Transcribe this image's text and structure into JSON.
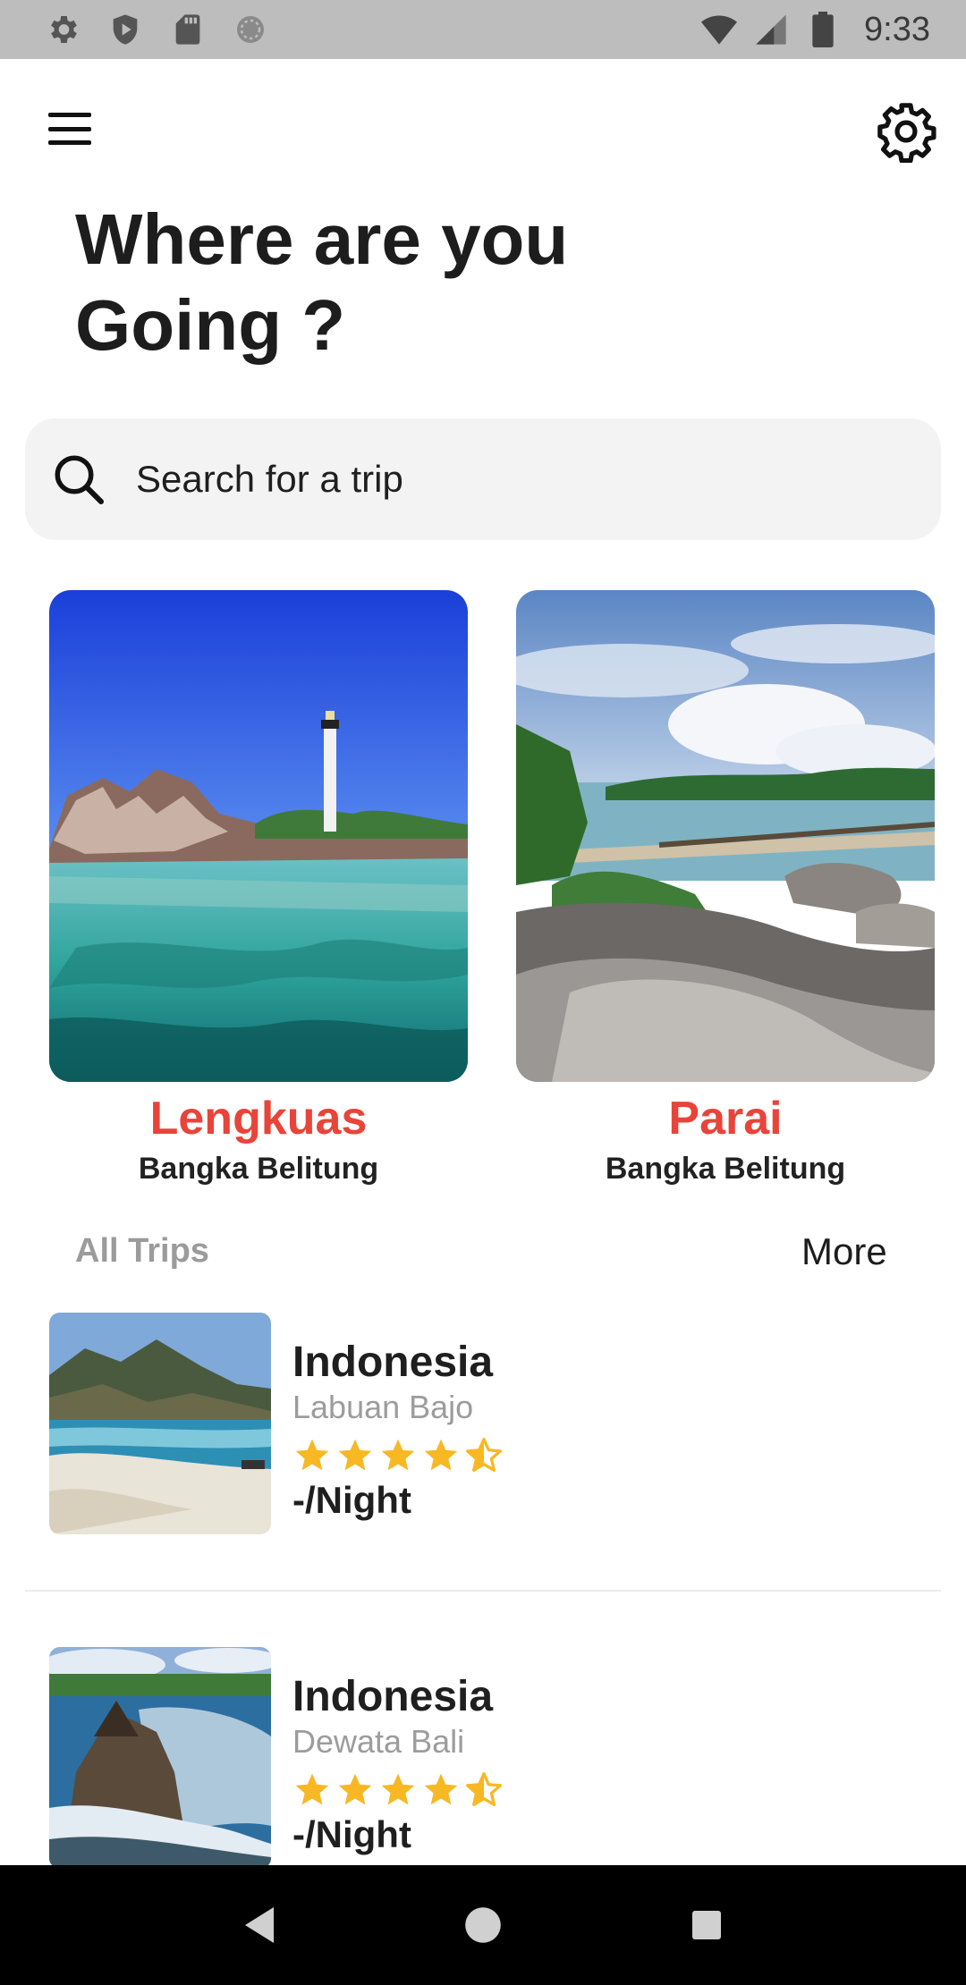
{
  "status_bar": {
    "time": "9:33",
    "icons": [
      "settings-icon",
      "shield-icon",
      "sd-card-icon",
      "sync-icon",
      "wifi-icon",
      "signal-icon",
      "battery-icon"
    ]
  },
  "header": {
    "menu_icon": "hamburger-menu-icon",
    "settings_icon": "gear-icon"
  },
  "title": {
    "line1": "Where are you",
    "line2": "Going ?"
  },
  "search": {
    "placeholder": "Search for a trip",
    "icon": "search-icon"
  },
  "featured": [
    {
      "name": "Lengkuas",
      "region": "Bangka Belitung",
      "image": "lighthouse-beach-photo"
    },
    {
      "name": "Parai",
      "region": "Bangka Belitung",
      "image": "rocky-beach-pier-photo"
    }
  ],
  "all_trips": {
    "title": "All Trips",
    "more_label": "More",
    "items": [
      {
        "country": "Indonesia",
        "city": "Labuan Bajo",
        "rating": 4.5,
        "price": "-/Night"
      },
      {
        "country": "Indonesia",
        "city": "Dewata Bali",
        "rating": 4.5,
        "price": "-/Night"
      }
    ]
  },
  "colors": {
    "accent": "#e8443a",
    "star": "#f8b824",
    "search_bg": "#f3f3f3",
    "status_bar": "#bdbdbd"
  },
  "nav_bar": {
    "icons": [
      "back-icon",
      "home-icon",
      "recents-icon"
    ]
  }
}
